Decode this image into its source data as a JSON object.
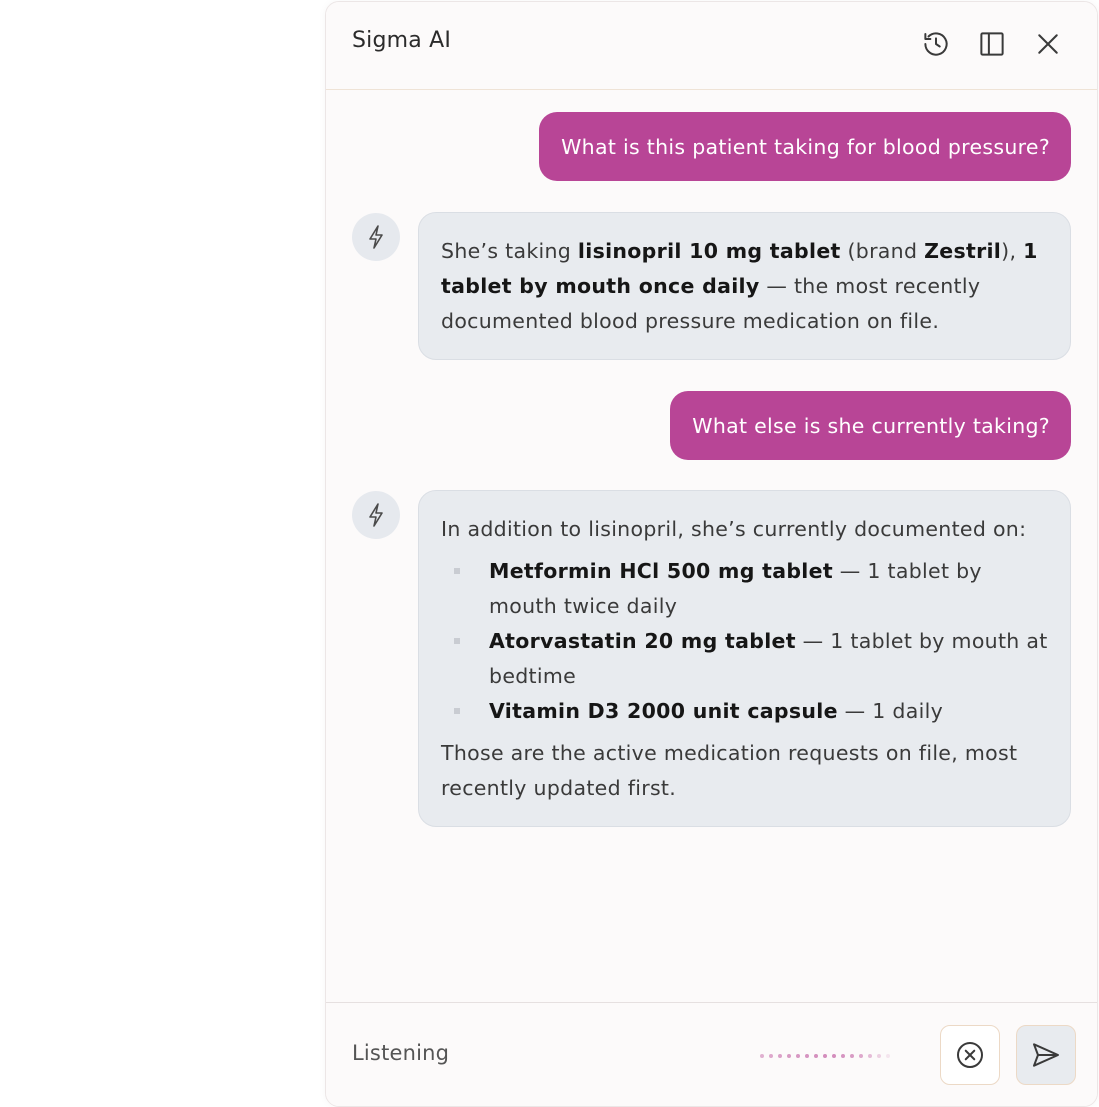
{
  "panel": {
    "title": "Sigma AI",
    "header_icons": [
      "history-icon",
      "sidebar-panel-icon",
      "close-icon"
    ]
  },
  "conversation": {
    "q1": "What is this patient taking for blood pressure?",
    "a1": {
      "t1": "She’s taking ",
      "b1": "lisinopril 10 mg tablet",
      "t2": " (brand ",
      "b2": "Zestril",
      "t3": "), ",
      "b3": "1 tablet by mouth once daily",
      "t4": " — the most recently documented blood pressure medication on file."
    },
    "q2": "What else is she currently taking?",
    "a2": {
      "intro": "In addition to lisinopril, she’s currently documented on:",
      "items": [
        {
          "name": "Metformin HCl 500 mg tablet",
          "detail": " — 1 tablet by mouth twice daily"
        },
        {
          "name": "Atorvastatin 20 mg tablet",
          "detail": " — 1 tablet by mouth at bedtime"
        },
        {
          "name": "Vitamin D3 2000 unit capsule",
          "detail": " — 1 daily"
        }
      ],
      "outro": "Those are the active medication requests on file, most recently updated first."
    },
    "bot_icon": "lightning-icon"
  },
  "input": {
    "status": "Listening",
    "cancel_icon": "cancel-circle-icon",
    "send_icon": "send-icon"
  },
  "colors": {
    "user_bubble": "#b84596",
    "bot_bubble": "#e8ebef",
    "accent_border": "#ecd9c6"
  }
}
